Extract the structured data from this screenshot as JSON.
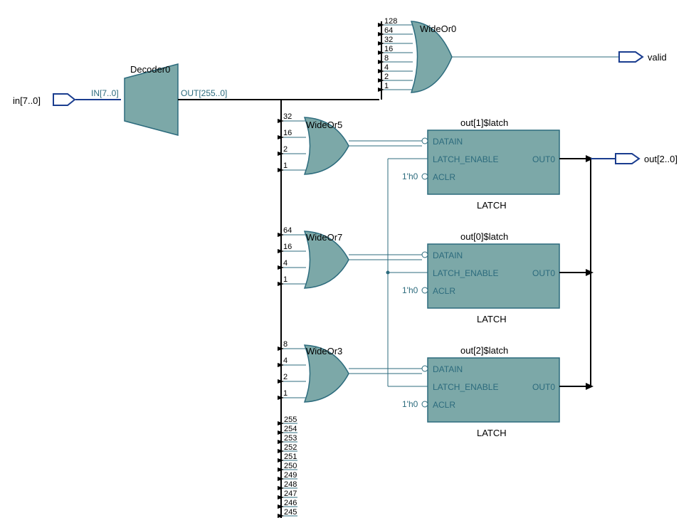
{
  "ports": {
    "input": {
      "name": "in[7..0]"
    },
    "valid": {
      "name": "valid"
    },
    "output": {
      "name": "out[2..0]"
    }
  },
  "decoder": {
    "title": "Decoder0",
    "in_label": "IN[7..0]",
    "out_label": "OUT[255..0]"
  },
  "wideor0": {
    "title": "WideOr0",
    "bits": [
      "128",
      "64",
      "32",
      "16",
      "8",
      "4",
      "2",
      "1"
    ]
  },
  "wideor5": {
    "title": "WideOr5",
    "bits": [
      "32",
      "16",
      "2",
      "1"
    ]
  },
  "wideor7": {
    "title": "WideOr7",
    "bits": [
      "64",
      "16",
      "4",
      "1"
    ]
  },
  "wideor3": {
    "title": "WideOr3",
    "bits": [
      "8",
      "4",
      "2",
      "1"
    ]
  },
  "latch1": {
    "title": "out[1]$latch",
    "datain": "DATAIN",
    "en": "LATCH_ENABLE",
    "aclr": "ACLR",
    "out": "OUT0",
    "type": "LATCH",
    "const": "1'h0"
  },
  "latch0": {
    "title": "out[0]$latch",
    "datain": "DATAIN",
    "en": "LATCH_ENABLE",
    "aclr": "ACLR",
    "out": "OUT0",
    "type": "LATCH",
    "const": "1'h0"
  },
  "latch2": {
    "title": "out[2]$latch",
    "datain": "DATAIN",
    "en": "LATCH_ENABLE",
    "aclr": "ACLR",
    "out": "OUT0",
    "type": "LATCH",
    "const": "1'h0"
  },
  "tailbits": [
    "255",
    "254",
    "253",
    "252",
    "251",
    "250",
    "249",
    "248",
    "247",
    "246",
    "245"
  ]
}
